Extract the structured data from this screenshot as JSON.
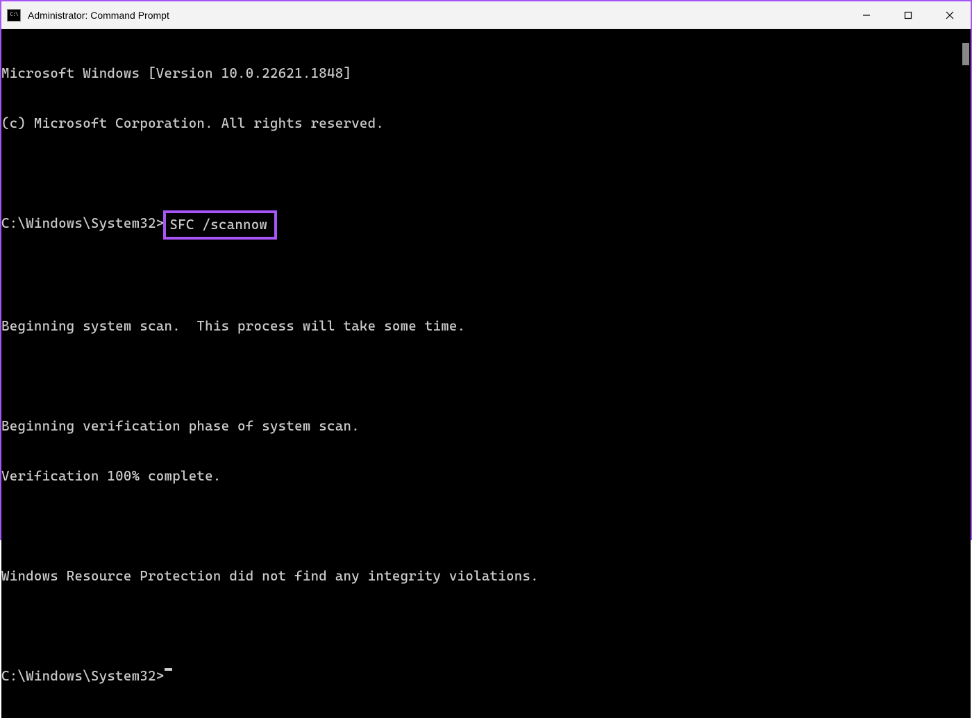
{
  "window": {
    "title": "Administrator: Command Prompt",
    "icon_label": "cmd-icon"
  },
  "terminal": {
    "lines": {
      "version": "Microsoft Windows [Version 10.0.22621.1848]",
      "copyright": "(c) Microsoft Corporation. All rights reserved.",
      "prompt1_path": "C:\\Windows\\System32>",
      "prompt1_command": "SFC /scannow",
      "scan_begin": "Beginning system scan.  This process will take some time.",
      "verify_begin": "Beginning verification phase of system scan.",
      "verify_complete": "Verification 100% complete.",
      "result": "Windows Resource Protection did not find any integrity violations.",
      "prompt2_path": "C:\\Windows\\System32>"
    }
  },
  "highlight_color": "#a855f7"
}
